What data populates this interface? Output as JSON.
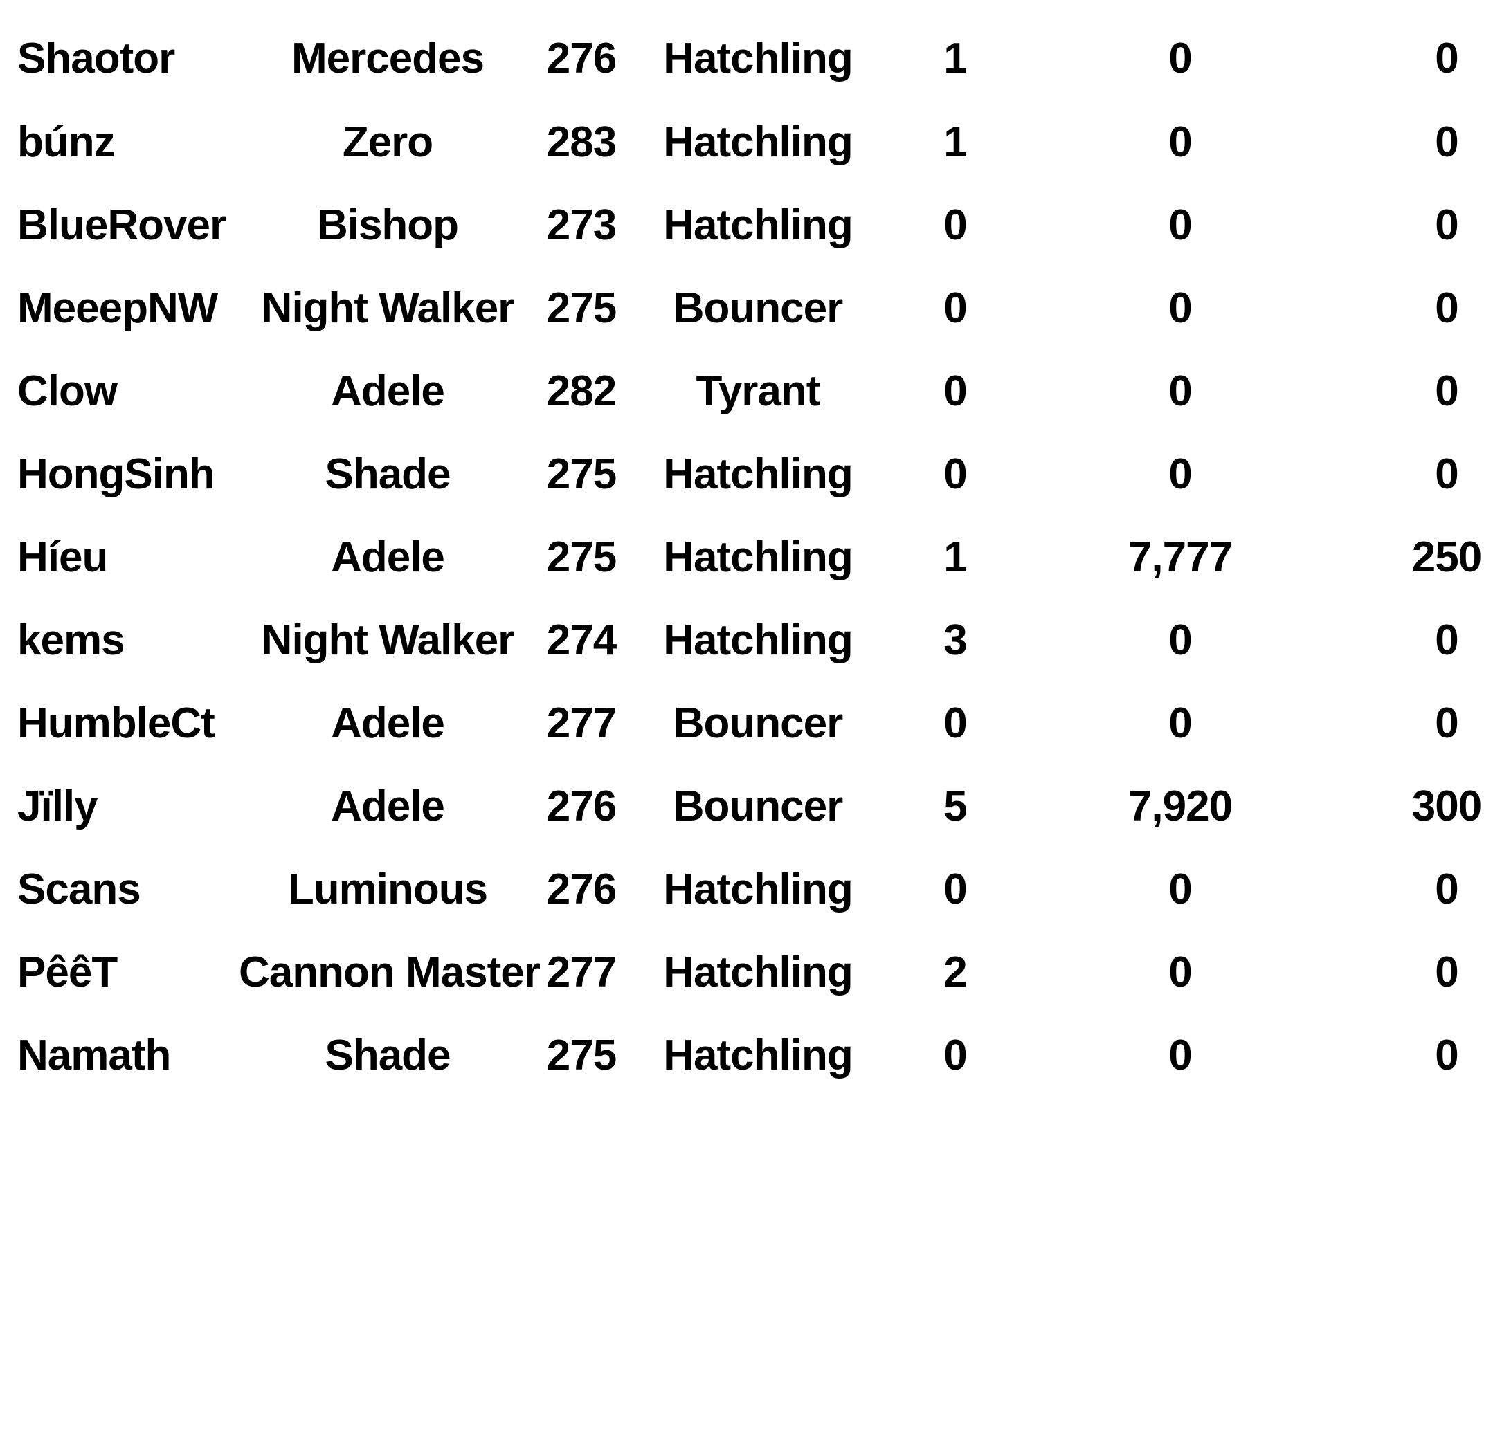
{
  "rows": [
    {
      "name": "Shaotor",
      "class": "Mercedes",
      "level": "276",
      "tier": "Hatchling",
      "col_a": "1",
      "col_b": "0",
      "col_c": "0"
    },
    {
      "name": "búnz",
      "class": "Zero",
      "level": "283",
      "tier": "Hatchling",
      "col_a": "1",
      "col_b": "0",
      "col_c": "0"
    },
    {
      "name": "BlueRover",
      "class": "Bishop",
      "level": "273",
      "tier": "Hatchling",
      "col_a": "0",
      "col_b": "0",
      "col_c": "0"
    },
    {
      "name": "MeeepNW",
      "class": "Night Walker",
      "level": "275",
      "tier": "Bouncer",
      "col_a": "0",
      "col_b": "0",
      "col_c": "0"
    },
    {
      "name": "Clow",
      "class": "Adele",
      "level": "282",
      "tier": "Tyrant",
      "col_a": "0",
      "col_b": "0",
      "col_c": "0"
    },
    {
      "name": "HongSinh",
      "class": "Shade",
      "level": "275",
      "tier": "Hatchling",
      "col_a": "0",
      "col_b": "0",
      "col_c": "0"
    },
    {
      "name": "Híeu",
      "class": "Adele",
      "level": "275",
      "tier": "Hatchling",
      "col_a": "1",
      "col_b": "7,777",
      "col_c": "250"
    },
    {
      "name": "kems",
      "class": "Night Walker",
      "level": "274",
      "tier": "Hatchling",
      "col_a": "3",
      "col_b": "0",
      "col_c": "0"
    },
    {
      "name": "HumbleCt",
      "class": "Adele",
      "level": "277",
      "tier": "Bouncer",
      "col_a": "0",
      "col_b": "0",
      "col_c": "0"
    },
    {
      "name": "Jïlly",
      "class": "Adele",
      "level": "276",
      "tier": "Bouncer",
      "col_a": "5",
      "col_b": "7,920",
      "col_c": "300"
    },
    {
      "name": "Scans",
      "class": "Luminous",
      "level": "276",
      "tier": "Hatchling",
      "col_a": "0",
      "col_b": "0",
      "col_c": "0"
    },
    {
      "name": "PêêT",
      "class": "Cannon Master",
      "level": "277",
      "tier": "Hatchling",
      "col_a": "2",
      "col_b": "0",
      "col_c": "0"
    },
    {
      "name": "Namath",
      "class": "Shade",
      "level": "275",
      "tier": "Hatchling",
      "col_a": "0",
      "col_b": "0",
      "col_c": "0"
    }
  ]
}
